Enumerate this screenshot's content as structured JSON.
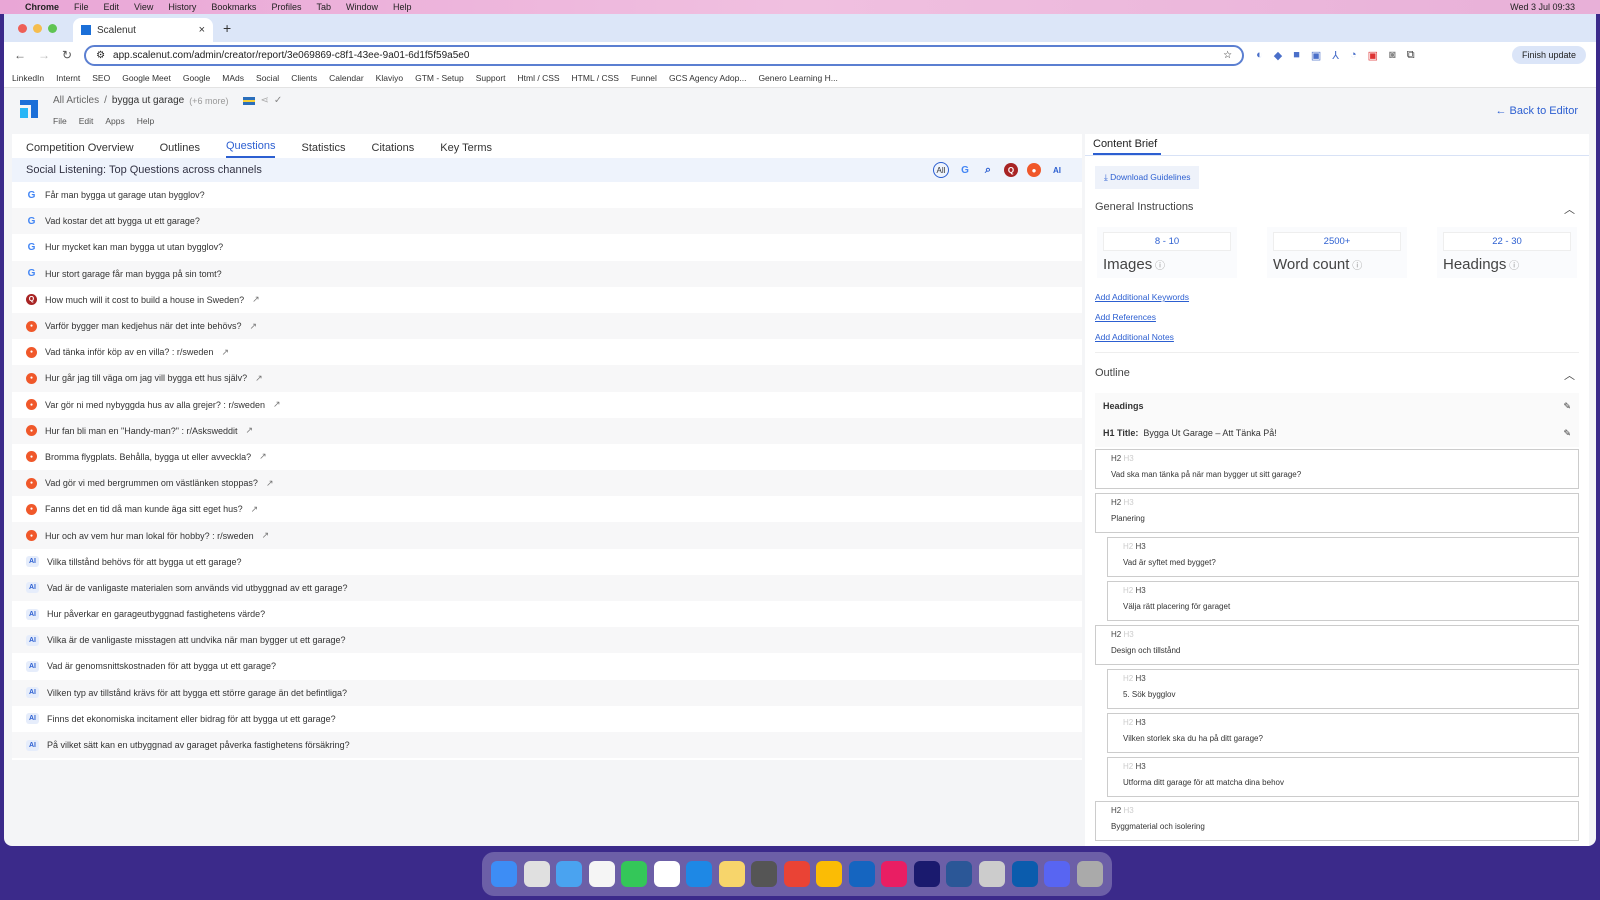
{
  "os": {
    "menu": [
      "Chrome",
      "File",
      "Edit",
      "View",
      "History",
      "Bookmarks",
      "Profiles",
      "Tab",
      "Window",
      "Help"
    ],
    "clock": "Wed 3 Jul 09:33"
  },
  "browser": {
    "tab_title": "Scalenut",
    "url": "app.scalenut.com/admin/creator/report/3e069869-c8f1-43ee-9a01-6d1f5f59a5e0",
    "finish_update": "Finish update",
    "bookmarks": [
      "LinkedIn",
      "Internt",
      "SEO",
      "Google Meet",
      "Google",
      "MAds",
      "Social",
      "Clients",
      "Calendar",
      "Klaviyo",
      "GTM - Setup",
      "Support",
      "Html / CSS",
      "HTML / CSS",
      "Funnel",
      "GCS Agency Adop...",
      "Genero Learning H..."
    ]
  },
  "app": {
    "breadcrumb_root": "All Articles",
    "breadcrumb_sep": "/",
    "article": "bygga ut garage",
    "more": "(+6 more)",
    "menu": [
      "File",
      "Edit",
      "Apps",
      "Help"
    ],
    "back": "← Back to Editor"
  },
  "tabs": [
    "Competition Overview",
    "Outlines",
    "Questions",
    "Statistics",
    "Citations",
    "Key Terms"
  ],
  "active_tab": "Questions",
  "section_title": "Social Listening: Top Questions across channels",
  "filters": [
    "All",
    "google",
    "search",
    "quora",
    "reddit",
    "AI"
  ],
  "questions": [
    {
      "src": "google",
      "text": "Får man bygga ut garage utan bygglov?"
    },
    {
      "src": "google",
      "text": "Vad kostar det att bygga ut ett garage?"
    },
    {
      "src": "google",
      "text": "Hur mycket kan man bygga ut utan bygglov?"
    },
    {
      "src": "google",
      "text": "Hur stort garage får man bygga på sin tomt?"
    },
    {
      "src": "quora",
      "text": "How much will it cost to build a house in Sweden?",
      "link": true
    },
    {
      "src": "reddit",
      "text": "Varför bygger man kedjehus när det inte behövs?",
      "link": true
    },
    {
      "src": "reddit",
      "text": "Vad tänka inför köp av en villa? : r/sweden",
      "link": true
    },
    {
      "src": "reddit",
      "text": "Hur går jag till väga om jag vill bygga ett hus själv?",
      "link": true
    },
    {
      "src": "reddit",
      "text": "Var gör ni med nybyggda hus av alla grejer? : r/sweden",
      "link": true
    },
    {
      "src": "reddit",
      "text": "Hur fan bli man en \"Handy-man?\" : r/Asksweddit",
      "link": true
    },
    {
      "src": "reddit",
      "text": "Bromma flygplats. Behålla, bygga ut eller avveckla?",
      "link": true
    },
    {
      "src": "reddit",
      "text": "Vad gör vi med bergrummen om västlänken stoppas?",
      "link": true
    },
    {
      "src": "reddit",
      "text": "Fanns det en tid då man kunde äga sitt eget hus?",
      "link": true
    },
    {
      "src": "reddit",
      "text": "Hur och av vem hur man lokal för hobby? : r/sweden",
      "link": true
    },
    {
      "src": "ai",
      "text": "Vilka tillstånd behövs för att bygga ut ett garage?"
    },
    {
      "src": "ai",
      "text": "Vad är de vanligaste materialen som används vid utbyggnad av ett garage?"
    },
    {
      "src": "ai",
      "text": "Hur påverkar en garageutbyggnad fastighetens värde?"
    },
    {
      "src": "ai",
      "text": "Vilka är de vanligaste misstagen att undvika när man bygger ut ett garage?"
    },
    {
      "src": "ai",
      "text": "Vad är genomsnittskostnaden för att bygga ut ett garage?"
    },
    {
      "src": "ai",
      "text": "Vilken typ av tillstånd krävs för att bygga ett större garage än det befintliga?"
    },
    {
      "src": "ai",
      "text": "Finns det ekonomiska incitament eller bidrag för att bygga ut ett garage?"
    },
    {
      "src": "ai",
      "text": "På vilket sätt kan en utbyggnad av garaget påverka fastighetens försäkring?"
    }
  ],
  "brief": {
    "tab": "Content Brief",
    "download": "Download Guidelines",
    "general": "General Instructions",
    "stats": [
      {
        "value": "8 - 10",
        "label": "Images"
      },
      {
        "value": "2500+",
        "label": "Word count"
      },
      {
        "value": "22 - 30",
        "label": "Headings"
      }
    ],
    "links": [
      "Add Additional Keywords",
      "Add References",
      "Add Additional Notes"
    ],
    "outline": "Outline",
    "headings": "Headings",
    "h1_label": "H1 Title:",
    "h1": "Bygga Ut Garage – Att Tänka På!",
    "items": [
      {
        "level": "H2",
        "text": "Vad ska man tänka på när man bygger ut sitt garage?"
      },
      {
        "level": "H2",
        "text": "Planering"
      },
      {
        "level": "H3",
        "text": "Vad är syftet med bygget?"
      },
      {
        "level": "H3",
        "text": "Välja rätt placering för garaget"
      },
      {
        "level": "H2",
        "text": "Design och tillstånd"
      },
      {
        "level": "H3",
        "text": "5. Sök bygglov"
      },
      {
        "level": "H3",
        "text": "Vilken storlek ska du ha på ditt garage?"
      },
      {
        "level": "H3",
        "text": "Utforma ditt garage för att matcha dina behov"
      },
      {
        "level": "H2",
        "text": "Byggmaterial och isolering"
      }
    ]
  }
}
